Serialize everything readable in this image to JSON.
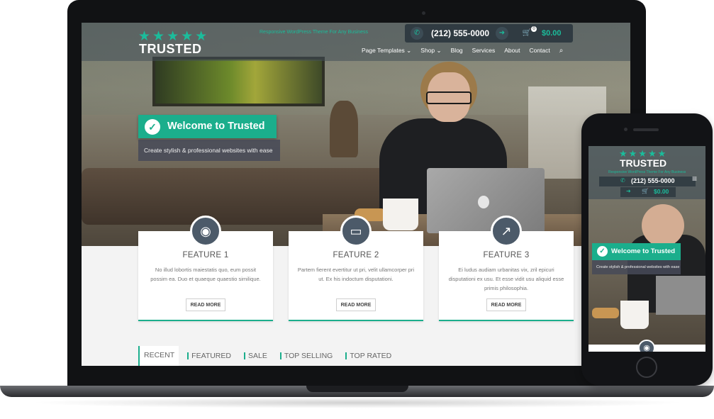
{
  "colors": {
    "accent": "#1bae8c",
    "accent_text": "#1bbc9b",
    "header_overlay": "#414e58",
    "feature_icon_bg": "#4c5a69",
    "device_frame": "#111214"
  },
  "desktop": {
    "header": {
      "logo_stars": "★★★★★",
      "logo_text": "TRUSTED",
      "tagline": "Responsive WordPress Theme For Any Business",
      "phone_icon": "phone-icon",
      "phone": "(212) 555-0000",
      "login_icon": "sign-in-icon",
      "cart_icon": "cart-icon",
      "cart_count": "0",
      "cart_total": "$0.00",
      "search_icon": "search-icon",
      "nav": [
        {
          "label": "Page Templates ⌄"
        },
        {
          "label": "Shop ⌄"
        },
        {
          "label": "Blog"
        },
        {
          "label": "Services"
        },
        {
          "label": "About"
        },
        {
          "label": "Contact"
        }
      ]
    },
    "hero": {
      "check_icon": "check-icon",
      "title": "Welcome to Trusted",
      "subtitle": "Create stylish & professional websites with ease"
    },
    "features": [
      {
        "icon": "camera-icon",
        "title": "FEATURE 1",
        "text": "No illud lobortis maiestatis quo, eum possit possim ea. Duo et quaeque quaestio similique.",
        "button": "READ MORE"
      },
      {
        "icon": "laptop-icon",
        "title": "FEATURE 2",
        "text": "Partem fierent evertitur ut pri, velit ullamcorper pri ut. Ex his indoctum disputationi.",
        "button": "READ MORE"
      },
      {
        "icon": "rocket-icon",
        "title": "FEATURE 3",
        "text": "Ei ludus audiam urbanitas vix, zril epicuri disputationi ex usu. Et esse vidit usu aliquid esse primis philosophia.",
        "button": "READ MORE"
      }
    ],
    "tabs": [
      {
        "label": "RECENT",
        "active": true
      },
      {
        "label": "FEATURED",
        "active": false
      },
      {
        "label": "SALE",
        "active": false
      },
      {
        "label": "TOP SELLING",
        "active": false
      },
      {
        "label": "TOP RATED",
        "active": false
      }
    ]
  },
  "mobile": {
    "logo_stars": "★★★★★",
    "logo_text": "TRUSTED",
    "tagline": "Responsive WordPress Theme For Any Business",
    "menu_icon": "hamburger-menu-icon",
    "phone": "(212) 555-0000",
    "cart_total": "$0.00",
    "hero_title": "Welcome to Trusted",
    "hero_subtitle": "Create stylish & professional websites with ease",
    "feature_icon": "camera-icon"
  }
}
